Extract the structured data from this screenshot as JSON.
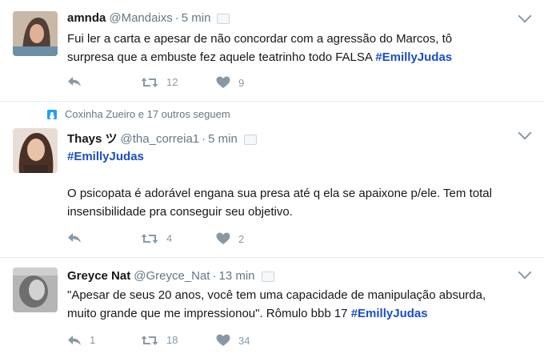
{
  "tweets": [
    {
      "name": "amnda",
      "handle": "@Mandaixs",
      "separator": "·",
      "time": "5 min",
      "text_lines": [
        "Fui ler a carta e apesar de não concordar com a agressão do Marcos, tô",
        "surpresa que a embuste fez aquele teatrinho todo FALSA "
      ],
      "hashtag": "#EmillyJudas",
      "reply_count": "",
      "retweet_count": "12",
      "like_count": "9",
      "avatar_color": "#3c2a24"
    },
    {
      "context": "Coxinha Zueiro e 17 outros seguem",
      "name": "Thays ツ",
      "handle": "@tha_correia1",
      "separator": "·",
      "time": "5 min",
      "hashtag": "#EmillyJudas",
      "text_lines": [
        "O psicopata é adorável engana sua presa  até q ela se apaixone p/ele. Tem total",
        "insensibilidade pra conseguir seu objetivo."
      ],
      "reply_count": "",
      "retweet_count": "4",
      "like_count": "2",
      "avatar_color": "#5a3a2c"
    },
    {
      "name": "Greyce Nat",
      "handle": "@Greyce_Nat",
      "separator": "·",
      "time": "13 min",
      "text_lines": [
        "\"Apesar de seus 20 anos, você tem uma capacidade de manipulação absurda,",
        "muito grande que me impressionou\".  Rômulo bbb 17 "
      ],
      "hashtag": "#EmillyJudas",
      "reply_count": "1",
      "retweet_count": "18",
      "like_count": "34",
      "avatar_color": "#9a9a9a"
    }
  ]
}
